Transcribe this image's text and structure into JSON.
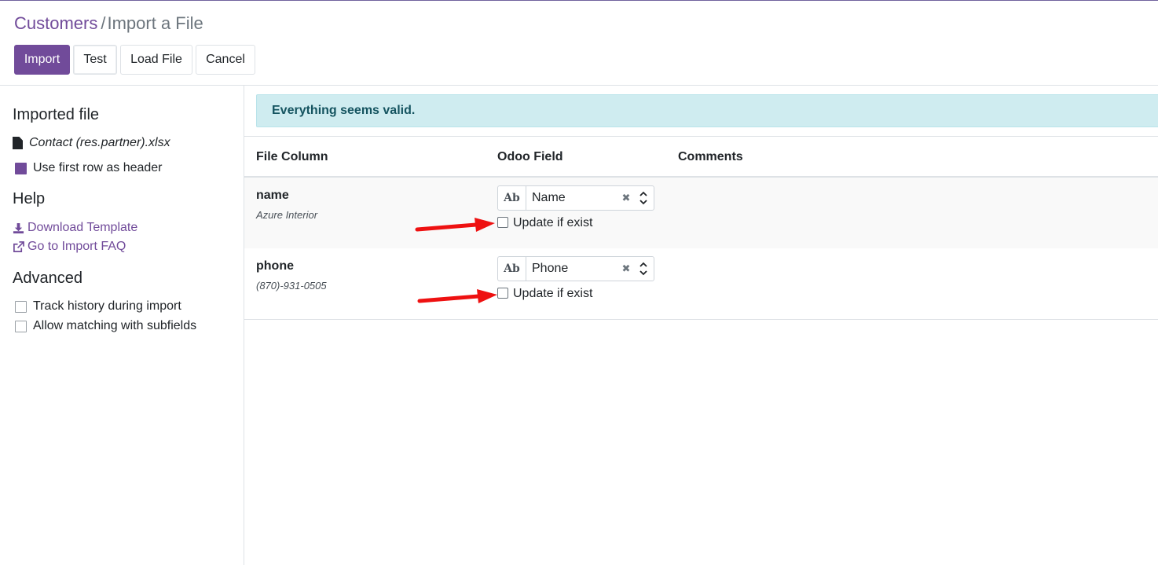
{
  "breadcrumb": {
    "parent": "Customers",
    "separator": "/",
    "current": "Import a File"
  },
  "toolbar": {
    "import_label": "Import",
    "test_label": "Test",
    "load_file_label": "Load File",
    "cancel_label": "Cancel"
  },
  "sidebar": {
    "imported_file_heading": "Imported file",
    "file_name": "Contact (res.partner).xlsx",
    "first_row_header_label": "Use first row as header",
    "first_row_header_checked": true,
    "help_heading": "Help",
    "download_template_label": "Download Template",
    "import_faq_label": "Go to Import FAQ",
    "advanced_heading": "Advanced",
    "track_history_label": "Track history during import",
    "track_history_checked": false,
    "allow_matching_label": "Allow matching with subfields",
    "allow_matching_checked": false
  },
  "alert": {
    "message": "Everything seems valid."
  },
  "table": {
    "headers": [
      "File Column",
      "Odoo Field",
      "Comments"
    ],
    "rows": [
      {
        "column": "name",
        "sample": "Azure Interior",
        "field_badge": "Ab",
        "field": "Name",
        "update_label": "Update if exist",
        "update_checked": false
      },
      {
        "column": "phone",
        "sample": "(870)-931-0505",
        "field_badge": "Ab",
        "field": "Phone",
        "update_label": "Update if exist",
        "update_checked": false
      }
    ]
  },
  "colors": {
    "brand": "#714b9a",
    "alert_bg": "#cfecf0",
    "alert_text": "#155460",
    "annotation_arrow": "#ee1111"
  },
  "icons": {
    "file": "file-icon",
    "download": "download-icon",
    "external_link": "external-link-icon",
    "clear": "clear-icon",
    "updown": "updown-icon"
  }
}
